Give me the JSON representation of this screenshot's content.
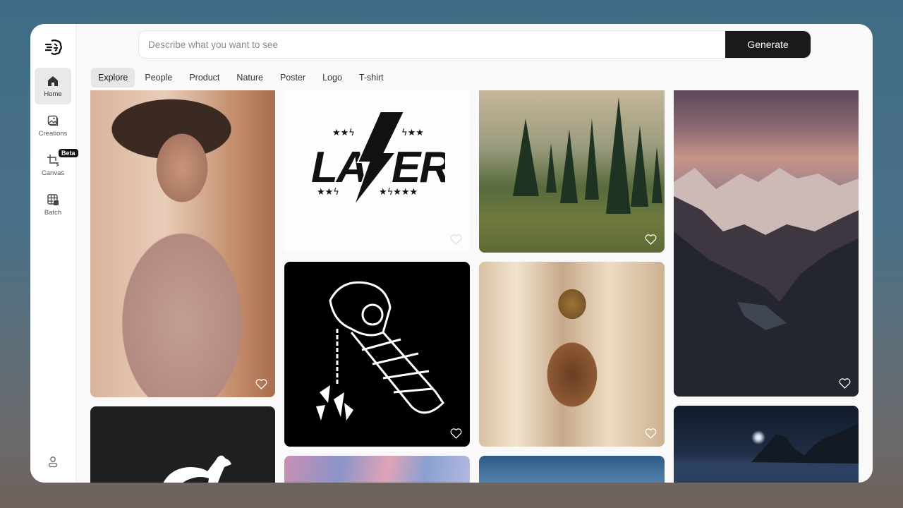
{
  "sidebar": {
    "logo": "brain-logo-icon",
    "items": [
      {
        "label": "Home",
        "icon": "home-icon",
        "active": true
      },
      {
        "label": "Creations",
        "icon": "image-icon"
      },
      {
        "label": "Canvas",
        "icon": "canvas-crop-icon",
        "badge": "Beta"
      },
      {
        "label": "Batch",
        "icon": "grid-image-icon"
      }
    ],
    "profile_icon": "user-icon"
  },
  "search": {
    "placeholder": "Describe what you want to see",
    "value": "",
    "generate_label": "Generate"
  },
  "tabs": [
    {
      "label": "Explore",
      "active": true
    },
    {
      "label": "People"
    },
    {
      "label": "Product"
    },
    {
      "label": "Nature"
    },
    {
      "label": "Poster"
    },
    {
      "label": "Logo"
    },
    {
      "label": "T-shirt"
    }
  ],
  "gallery": [
    {
      "description": "Woman in pink turtleneck portrait",
      "favorite_icon": "heart-icon"
    },
    {
      "description": "LAZER lightning bolt logo with stars",
      "logo_text": "LA ER",
      "favorite_icon": "heart-icon"
    },
    {
      "description": "Misty pine forest meadow",
      "favorite_icon": "heart-icon"
    },
    {
      "description": "Mountain valley at dusk",
      "favorite_icon": "heart-icon"
    },
    {
      "description": "Black and white gauntlet with chain illustration",
      "favorite_icon": "heart-icon"
    },
    {
      "description": "Amber perfume bottle with bokeh",
      "favorite_icon": "heart-icon"
    },
    {
      "description": "White kangaroo logo on dark background"
    },
    {
      "description": "Pink and blue pastel gradient"
    },
    {
      "description": "Blue blurred gradient"
    },
    {
      "description": "Moonlit coastline at night"
    }
  ]
}
